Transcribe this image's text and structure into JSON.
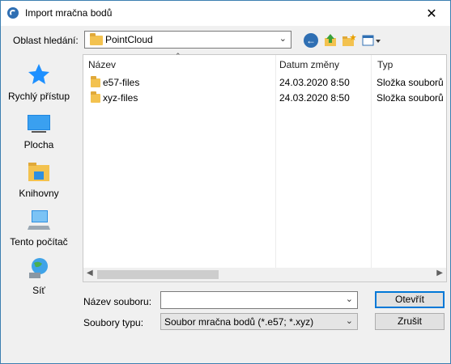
{
  "window": {
    "title": "Import mračna bodů",
    "close_glyph": "✕"
  },
  "lookin": {
    "label": "Oblast hledání:",
    "value": "PointCloud"
  },
  "toolbar_icons": [
    "back-icon",
    "up-folder-icon",
    "new-folder-icon",
    "views-menu-icon"
  ],
  "places": [
    {
      "label": "Rychlý přístup",
      "icon": "star-icon"
    },
    {
      "label": "Plocha",
      "icon": "desktop-icon"
    },
    {
      "label": "Knihovny",
      "icon": "libraries-icon"
    },
    {
      "label": "Tento počítač",
      "icon": "computer-icon"
    },
    {
      "label": "Síť",
      "icon": "network-icon"
    }
  ],
  "filelist": {
    "columns": [
      "Název",
      "Datum změny",
      "Typ"
    ],
    "rows": [
      {
        "name": "e57-files",
        "date": "24.03.2020 8:50",
        "type": "Složka souborů"
      },
      {
        "name": "xyz-files",
        "date": "24.03.2020 8:50",
        "type": "Složka souborů"
      }
    ]
  },
  "filename": {
    "label": "Název souboru:",
    "value": ""
  },
  "filetype": {
    "label": "Soubory typu:",
    "value": "Soubor mračna bodů (*.e57; *.xyz)"
  },
  "buttons": {
    "open": "Otevřít",
    "cancel": "Zrušit"
  },
  "colors": {
    "accent": "#0078d7",
    "folder": "#f3c24f"
  }
}
